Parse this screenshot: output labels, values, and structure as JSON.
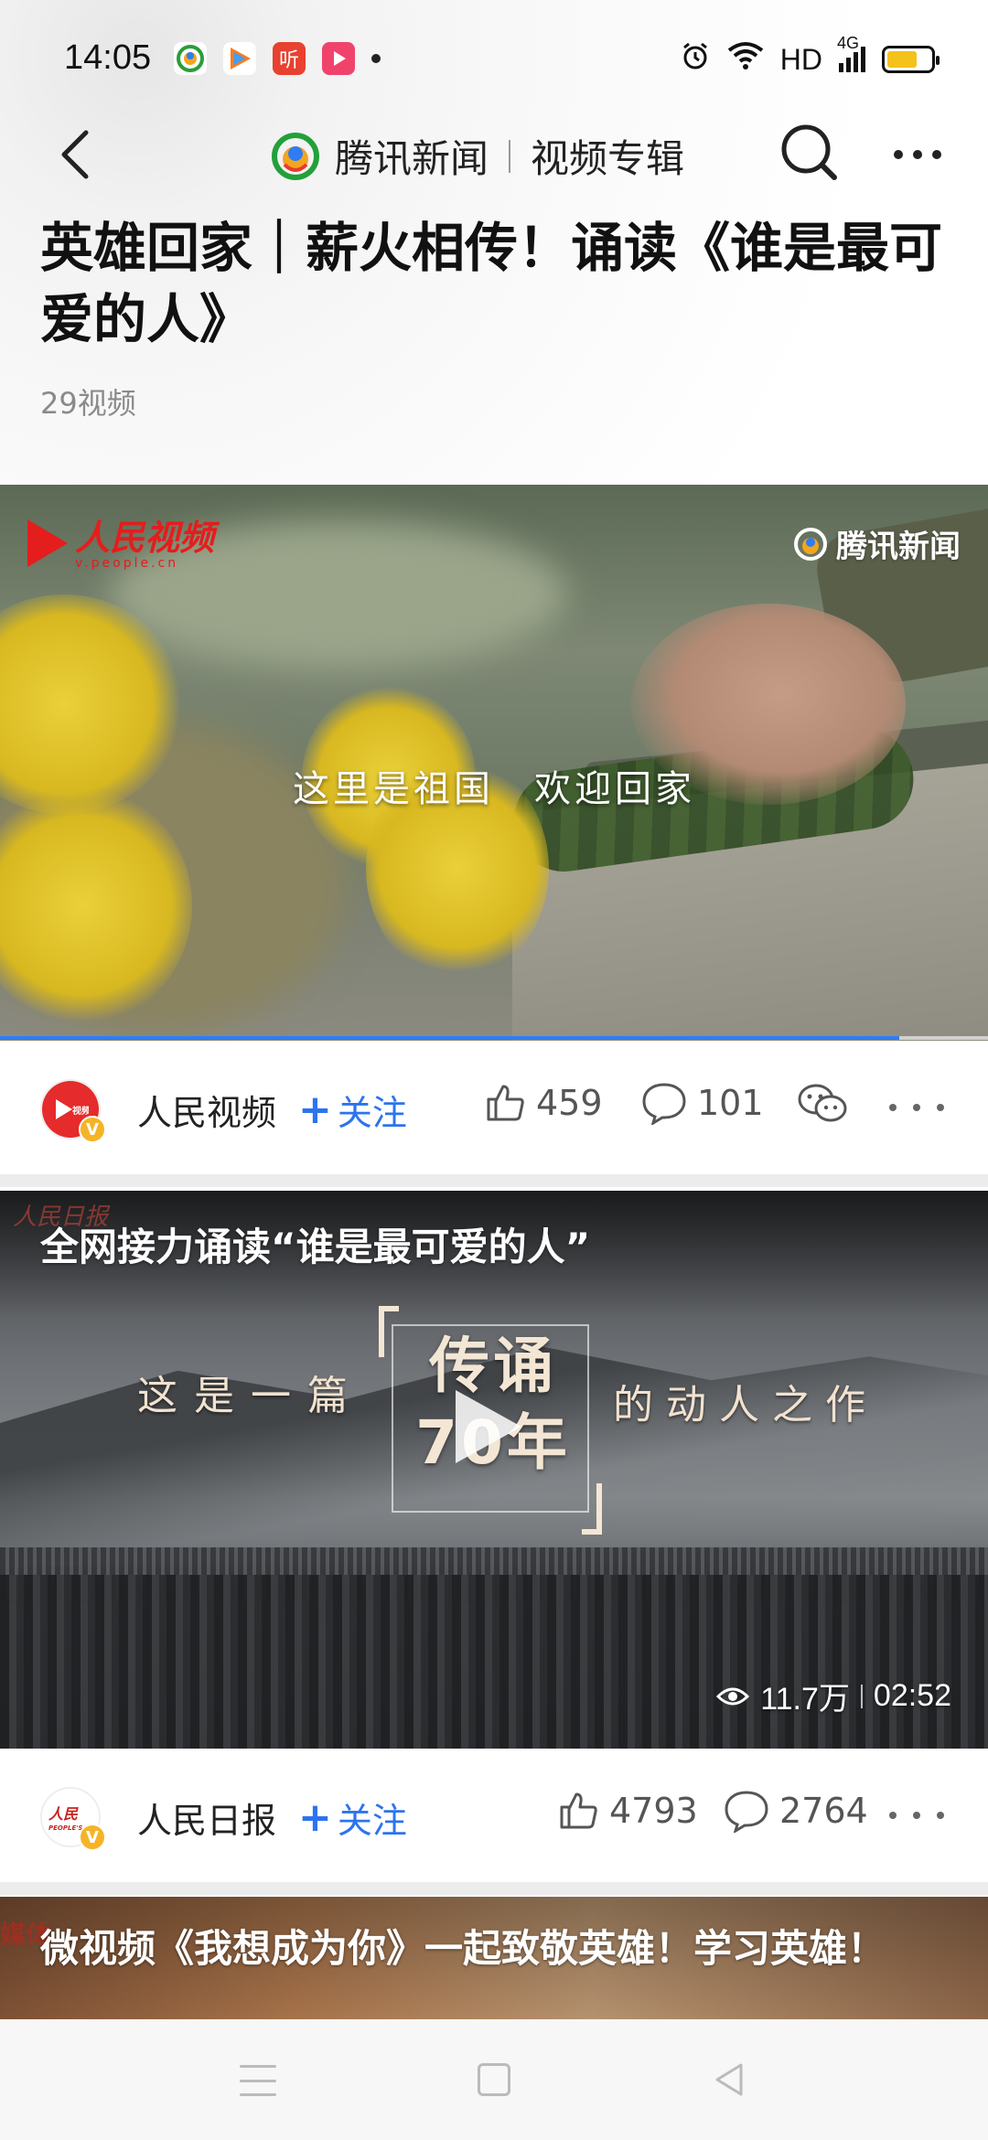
{
  "status_bar": {
    "time": "14:05",
    "network": "HD",
    "signal": "4G",
    "app_icons": [
      "tencent-news-icon",
      "tencent-video-icon",
      "listen-icon",
      "video-play-icon"
    ]
  },
  "nav": {
    "brand": "腾讯新闻",
    "subtitle": "视频专辑"
  },
  "album": {
    "title": "英雄回家｜薪火相传！诵读《谁是最可爱的人》",
    "count": "29视频"
  },
  "videos": [
    {
      "caption": "这里是祖国　欢迎回家",
      "watermark_left": "人民视频",
      "watermark_left_sub": "v.people.cn",
      "watermark_right": "腾讯新闻",
      "progress": 0.91,
      "author": "人民视频",
      "avatar_text": "人民视频",
      "follow": "关注",
      "likes": "459",
      "comments": "101"
    },
    {
      "title": "全网接力诵读“谁是最可爱的人”",
      "watermark": "人民日报",
      "phrase_left": "这是一篇",
      "big_text": "传诵70年",
      "phrase_right": "的动人之作",
      "views": "11.7万",
      "duration": "02:52",
      "author": "人民日报",
      "avatar_text": "人民日报",
      "follow": "关注",
      "likes": "4793",
      "comments": "2764"
    },
    {
      "title": "微视频《我想成为你》一起致敬英雄！学习英雄！",
      "watermark": "媒体"
    }
  ],
  "colors": {
    "accent": "#2b74ef",
    "verify_badge": "#f5b428",
    "brand_red": "#e41d1d"
  }
}
